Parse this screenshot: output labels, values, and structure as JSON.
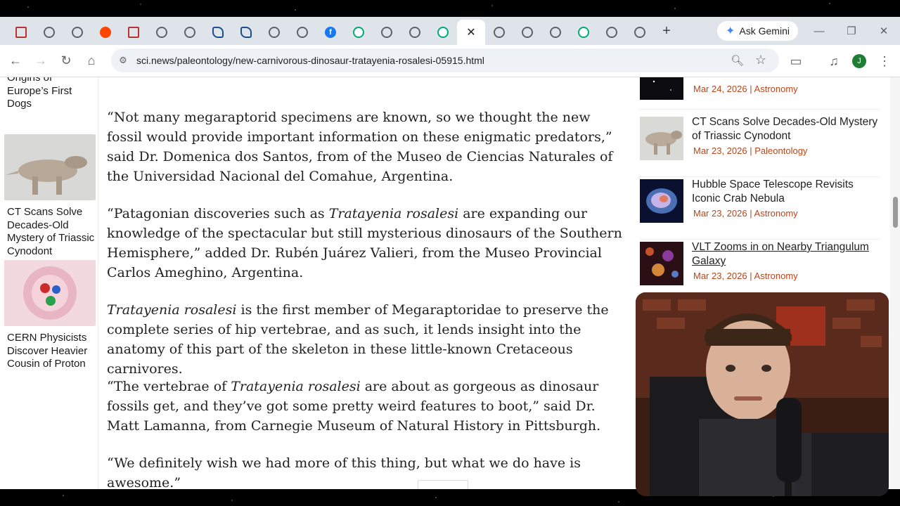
{
  "browser": {
    "tabs": [
      {
        "icon": "scinews-icon"
      },
      {
        "icon": "globe-icon"
      },
      {
        "icon": "globe-icon"
      },
      {
        "icon": "reddit-icon"
      },
      {
        "icon": "scinews-icon"
      },
      {
        "icon": "globe-icon"
      },
      {
        "icon": "globe-icon"
      },
      {
        "icon": "twitter-icon"
      },
      {
        "icon": "twitter-icon"
      },
      {
        "icon": "globe-icon"
      },
      {
        "icon": "globe-icon"
      },
      {
        "icon": "facebook-icon"
      },
      {
        "icon": "wikipedia-icon"
      },
      {
        "icon": "globe-icon"
      },
      {
        "icon": "globe-icon"
      },
      {
        "icon": "wikipedia-icon"
      },
      {
        "icon": "close-icon",
        "active": true
      },
      {
        "icon": "globe-icon"
      },
      {
        "icon": "globe-icon"
      },
      {
        "icon": "globe-icon"
      },
      {
        "icon": "wikipedia-icon"
      },
      {
        "icon": "globe-icon"
      },
      {
        "icon": "globe-icon"
      }
    ],
    "facebook_glyph": "f",
    "gemini_label": "Ask Gemini",
    "url": "sci.news/paleontology/new-carnivorous-dinosaur-tratayenia-rosalesi-05915.html",
    "profile_initial": "J"
  },
  "left_sidebar": {
    "partial_title": "Origins of Europe’s First Dogs",
    "items": [
      {
        "title": "CT Scans Solve Decades-Old Mystery of Triassic Cynodont"
      },
      {
        "title": "CERN Physicists Discover Heavier Cousin of Proton"
      }
    ]
  },
  "article": {
    "p1": "“Not many megaraptorid specimens are known, so we thought the new fossil would provide important information on these enigmatic predators,” said Dr. Domenica dos Santos, from of the Museo de Ciencias Naturales of the Universidad Nacional del Comahue, Argentina.",
    "p2_a": "“Patagonian discoveries such as ",
    "p2_i": "Tratayenia rosalesi",
    "p2_b": " are expanding our knowledge of the spectacular but still mysterious dinosaurs of the Southern Hemisphere,” added Dr. Rubén Juárez Valieri, from the Museo Provincial Carlos Ameghino, Argentina.",
    "p3_i": "Tratayenia rosalesi",
    "p3_b": " is the first member of Megaraptoridae to preserve the complete series of hip vertebrae, and as such, it lends insight into the anatomy of this part of the skeleton in these little-known Cretaceous carnivores.",
    "p4_a": "“The vertebrae of ",
    "p4_i": "Tratayenia rosalesi",
    "p4_b": " are about as gorgeous as dinosaur fossils get, and they’ve got some pretty weird features to boot,” said Dr. Matt Lamanna, from Carnegie Museum of Natural History in Pittsburgh.",
    "p5": "“We definitely wish we had more of this thing, but what we do have is awesome.”"
  },
  "right_sidebar": {
    "items": [
      {
        "title": "",
        "date": "Mar 24, 2026",
        "sep": "|",
        "category": "Astronomy"
      },
      {
        "title": "CT Scans Solve Decades-Old Mystery of Triassic Cynodont",
        "date": "Mar 23, 2026",
        "sep": "|",
        "category": "Paleontology"
      },
      {
        "title": "Hubble Space Telescope Revisits Iconic Crab Nebula",
        "date": "Mar 23, 2026",
        "sep": "|",
        "category": "Astronomy"
      },
      {
        "title": "VLT Zooms in on Nearby Triangulum Galaxy",
        "date": "Mar 23, 2026",
        "sep": "|",
        "category": "Astronomy"
      }
    ]
  }
}
